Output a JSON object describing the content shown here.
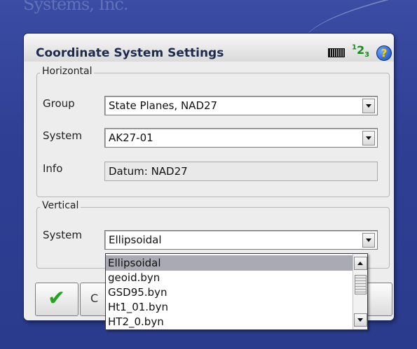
{
  "background": {
    "brand_text": "Systems, Inc."
  },
  "dialog": {
    "title": "Coordinate System Settings",
    "icons": {
      "keyboard": "keyboard-icon",
      "numeric": "numeric-input-icon",
      "help": "help-icon"
    },
    "numeric_label": {
      "a": "1",
      "b": "2",
      "c": "3"
    },
    "help_glyph": "?"
  },
  "horizontal": {
    "legend": "Horizontal",
    "group_label": "Group",
    "group_value": "State Planes, NAD27",
    "system_label": "System",
    "system_value": "AK27-01",
    "info_label": "Info",
    "info_value": "Datum: NAD27"
  },
  "vertical": {
    "legend": "Vertical",
    "system_label": "System",
    "system_value": "Ellipsoidal",
    "options": [
      "Ellipsoidal",
      "geoid.byn",
      "GSD95.byn",
      "Ht1_01.byn",
      "HT2_0.byn"
    ],
    "selected_index": 0
  },
  "buttons": {
    "ok_icon": "checkmark-icon",
    "cancel_partial": "C"
  },
  "colors": {
    "accent_green": "#23a51f",
    "title_color": "#1d2a4c",
    "selection_bg": "#a9aab3"
  }
}
